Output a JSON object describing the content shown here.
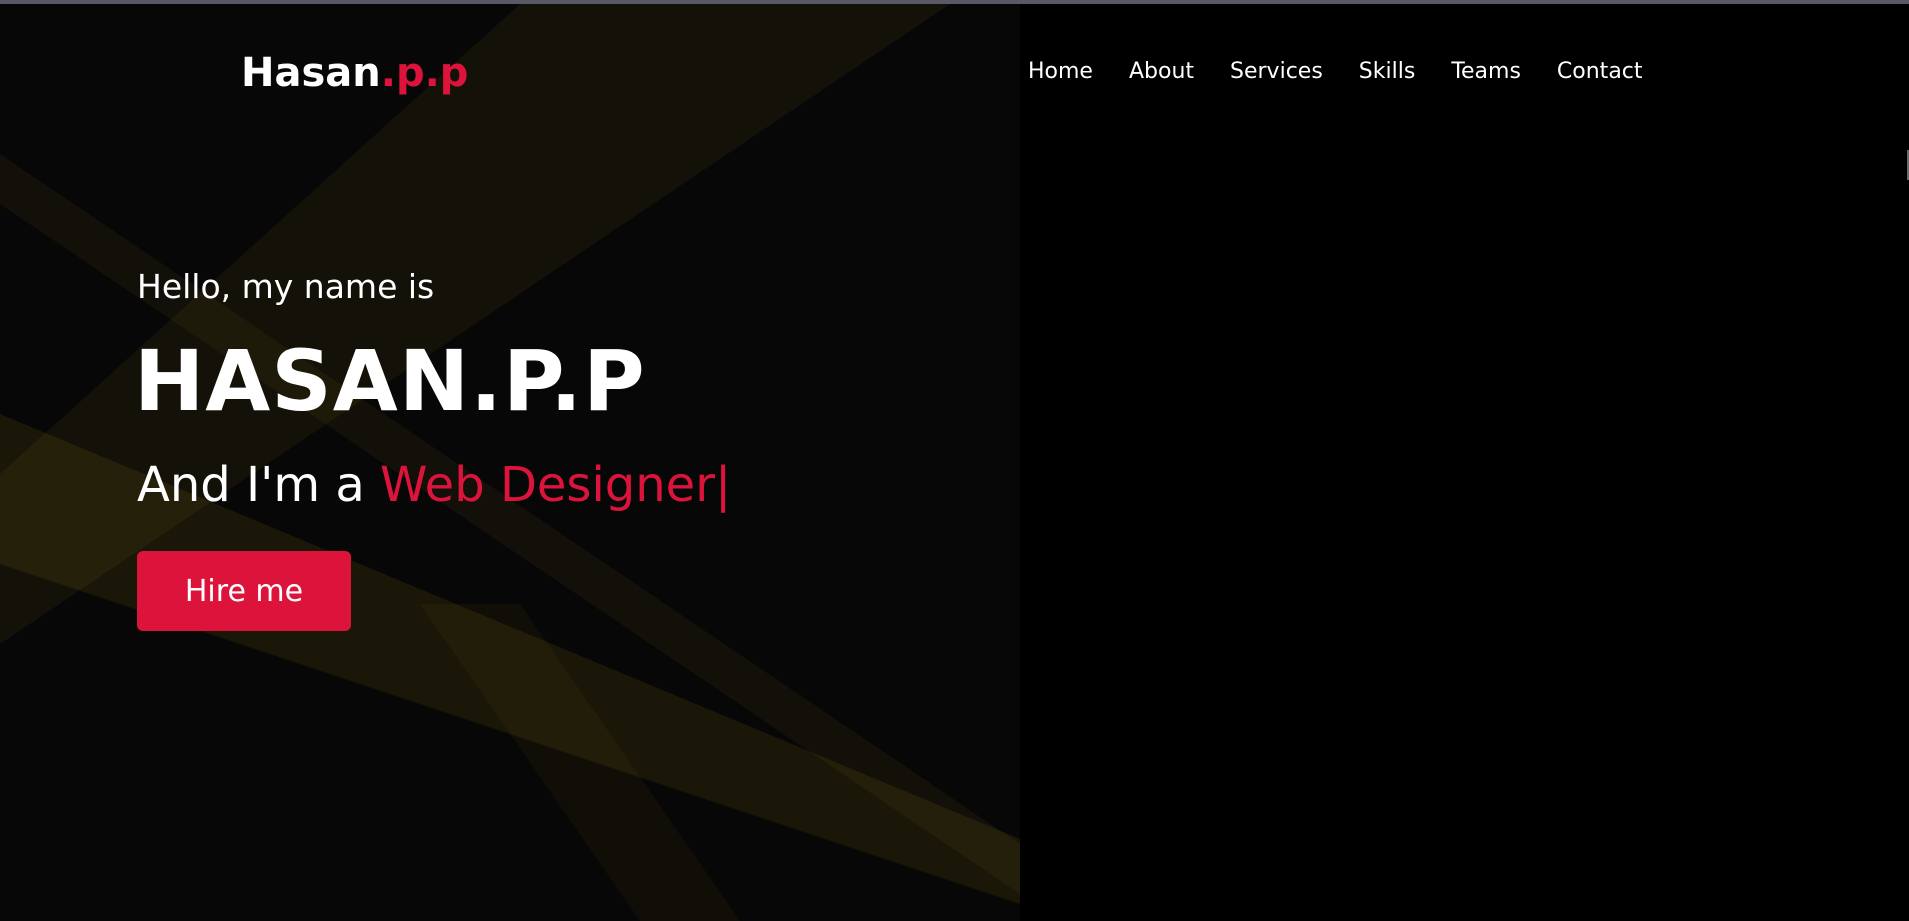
{
  "brand": {
    "name": "Hasan",
    "suffix": ".p.p"
  },
  "nav": {
    "items": [
      "Home",
      "About",
      "Services",
      "Skills",
      "Teams",
      "Contact"
    ]
  },
  "hero": {
    "greeting": "Hello, my name is",
    "name": "HASAN.P.P",
    "role_prefix": "And I'm a ",
    "role_highlight": "Web Designer",
    "cursor": "|",
    "cta_label": "Hire me"
  },
  "colors": {
    "accent": "#dc143c",
    "background": "#000000",
    "text": "#ffffff",
    "light_beam": "#3a2e12"
  }
}
